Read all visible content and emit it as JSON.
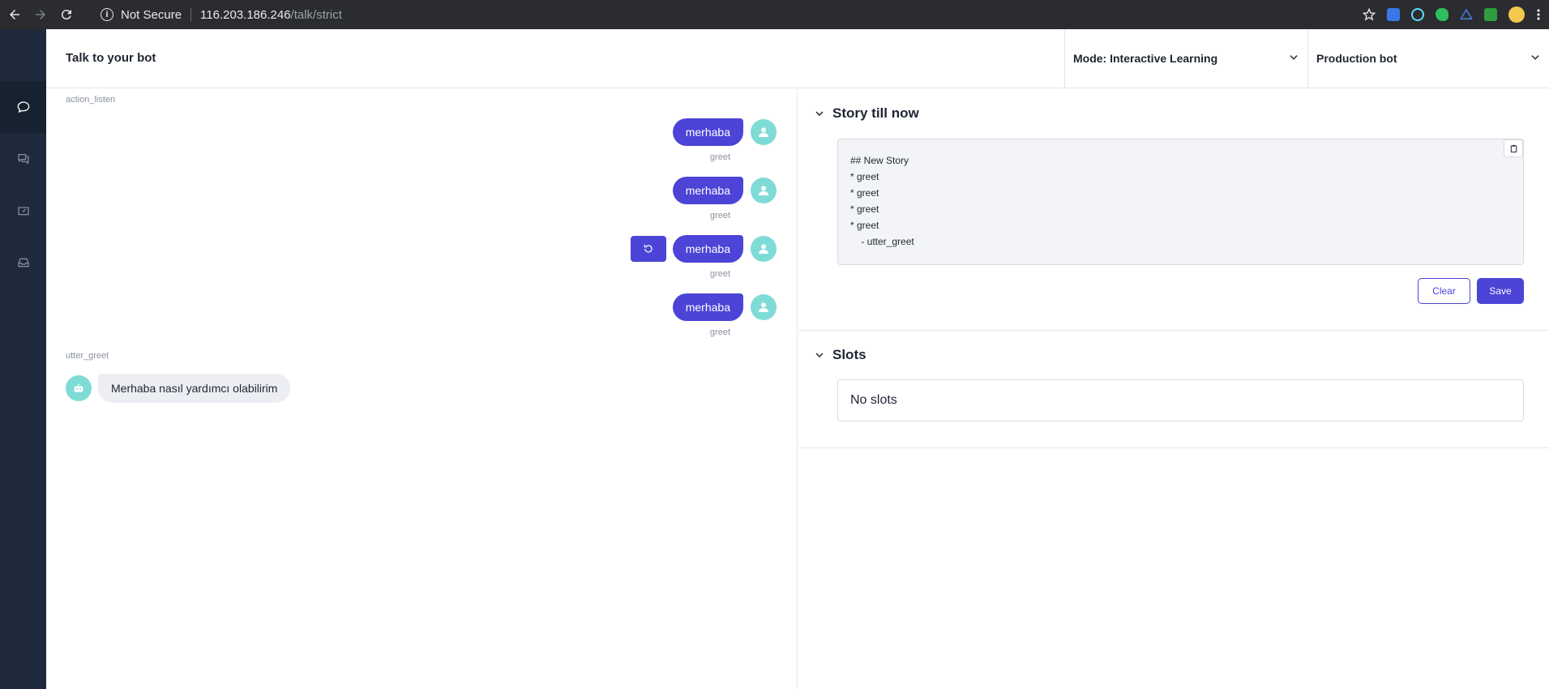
{
  "browser": {
    "security_label": "Not Secure",
    "url_host": "116.203.186.246",
    "url_path": "/talk/strict"
  },
  "header": {
    "title": "Talk to your bot",
    "mode_dropdown": "Mode: Interactive Learning",
    "bot_dropdown": "Production bot"
  },
  "chat": {
    "action_top": "action_listen",
    "user_messages": [
      {
        "text": "merhaba",
        "intent": "greet"
      },
      {
        "text": "merhaba",
        "intent": "greet"
      },
      {
        "text": "merhaba",
        "intent": "greet"
      },
      {
        "text": "merhaba",
        "intent": "greet"
      }
    ],
    "bot_action": "utter_greet",
    "bot_message": "Merhaba nasıl yardımcı olabilirim"
  },
  "story": {
    "title": "Story till now",
    "lines": [
      "## New Story",
      "* greet",
      "* greet",
      "* greet",
      "* greet",
      "    - utter_greet"
    ],
    "clear_label": "Clear",
    "save_label": "Save"
  },
  "slots": {
    "title": "Slots",
    "empty_text": "No slots"
  },
  "colors": {
    "accent": "#4b44d6",
    "avatar": "#7fdbd6",
    "sidebar": "#1e2a3b"
  },
  "icons": {
    "sidebar": [
      "chat-bubble-icon",
      "conversations-icon",
      "dashboard-icon",
      "inbox-icon"
    ]
  }
}
